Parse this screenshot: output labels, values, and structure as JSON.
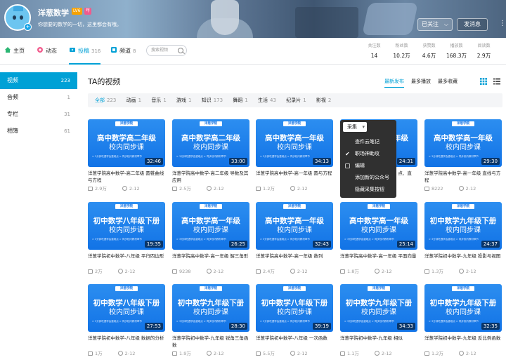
{
  "header": {
    "username": "洋葱数学",
    "level": "LV6",
    "vip_badge": "年",
    "avatar_badge": "+",
    "signature": "你想要的数学的一切，这里都会有哦。",
    "follow_label": "已关注",
    "message_label": "发消息",
    "more_icon": "⋮",
    "colors": {
      "accent": "#00a1d6",
      "level": "#f7a200",
      "vip": "#f05b8d"
    }
  },
  "nav": {
    "tabs": [
      {
        "label": "主页",
        "icon": "home-icon",
        "count": ""
      },
      {
        "label": "动态",
        "icon": "dynamic-icon",
        "count": ""
      },
      {
        "label": "投稿",
        "icon": "upload-icon",
        "count": "316"
      },
      {
        "label": "频道",
        "icon": "channel-icon",
        "count": "8"
      }
    ],
    "search_placeholder": "搜索视频",
    "stats": [
      {
        "label": "关注数",
        "value": "14"
      },
      {
        "label": "粉丝数",
        "value": "10.2万"
      },
      {
        "label": "获赞数",
        "value": "4.6万"
      },
      {
        "label": "播放数",
        "value": "168.3万"
      },
      {
        "label": "阅读数",
        "value": "2.9万"
      }
    ]
  },
  "sidebar": {
    "items": [
      {
        "label": "视频",
        "count": "223"
      },
      {
        "label": "音频",
        "count": "1"
      },
      {
        "label": "专栏",
        "count": "31"
      },
      {
        "label": "相簿",
        "count": "61"
      }
    ]
  },
  "main": {
    "title": "TA的视频",
    "sorts": [
      "最新发布",
      "最多播放",
      "最多收藏"
    ],
    "filters": [
      {
        "label": "全部",
        "count": "223"
      },
      {
        "label": "动画",
        "count": "1"
      },
      {
        "label": "音乐",
        "count": "1"
      },
      {
        "label": "游戏",
        "count": "1"
      },
      {
        "label": "知识",
        "count": "173"
      },
      {
        "label": "舞蹈",
        "count": "1"
      },
      {
        "label": "生活",
        "count": "43"
      },
      {
        "label": "纪录片",
        "count": "1"
      },
      {
        "label": "影视",
        "count": "2"
      }
    ],
    "thumb_logo": "洋葱学院",
    "thumb_sub": "校内同步课",
    "thumb_tagline": "> 3分钟吃透学会重难点    > 同步校内教材章节",
    "videos": [
      {
        "thumb": "高中数学高二年级",
        "duration": "32:46",
        "title": "洋葱学院高中数学-高二年级 圆锥曲线与方程",
        "plays": "2.9万",
        "date": "2-12"
      },
      {
        "thumb": "高中数学高二年级",
        "duration": "33:00",
        "title": "洋葱学院高中数学-高二年级 导数及其应用",
        "plays": "2.5万",
        "date": "2-12"
      },
      {
        "thumb": "高中数学高一年级",
        "duration": "34:13",
        "title": "洋葱学院高中数学-高一年级 圆与方程",
        "plays": "1.2万",
        "date": "2-12"
      },
      {
        "thumb": "高中数学高一年级",
        "duration": "24:31",
        "title": "洋葱学院高中数学-高一年级 点、直线、平面之间的位置关系",
        "plays": "1.1万",
        "date": "2-12"
      },
      {
        "thumb": "高中数学高一年级",
        "duration": "29:30",
        "title": "洋葱学院高中数学-高一年级 直线与方程",
        "plays": "8222",
        "date": "2-12"
      },
      {
        "thumb": "初中数学八年级下册",
        "duration": "19:35",
        "title": "洋葱学院初中数学-八年级 平行四边形",
        "plays": "2万",
        "date": "2-12"
      },
      {
        "thumb": "高中数学高一年级",
        "duration": "26:25",
        "title": "洋葱学院高中数学-高一年级 解三角形",
        "plays": "9238",
        "date": "2-12"
      },
      {
        "thumb": "高中数学高一年级",
        "duration": "32:43",
        "title": "洋葱学院高中数学-高一年级 数列",
        "plays": "2.4万",
        "date": "2-12"
      },
      {
        "thumb": "高中数学高一年级",
        "duration": "25:14",
        "title": "洋葱学院高中数学-高一年级 平面向量",
        "plays": "1.8万",
        "date": "2-12"
      },
      {
        "thumb": "初中数学九年级下册",
        "duration": "24:37",
        "title": "洋葱学院初中数学-九年级 投影与视图",
        "plays": "1.3万",
        "date": "2-12"
      },
      {
        "thumb": "初中数学八年级下册",
        "duration": "27:53",
        "title": "洋葱学院初中数学-八年级 数据的分析",
        "plays": "1万",
        "date": "2-12"
      },
      {
        "thumb": "初中数学九年级下册",
        "duration": "28:30",
        "title": "洋葱学院初中数学-九年级 锐角三角函数",
        "plays": "1.9万",
        "date": "2-12"
      },
      {
        "thumb": "初中数学八年级下册",
        "duration": "39:19",
        "title": "洋葱学院初中数学-八年级 一次函数",
        "plays": "5.5万",
        "date": "2-12"
      },
      {
        "thumb": "初中数学九年级下册",
        "duration": "34:33",
        "title": "洋葱学院初中数学-九年级 相似",
        "plays": "1.1万",
        "date": "2-12"
      },
      {
        "thumb": "初中数学九年级下册",
        "duration": "32:35",
        "title": "洋葱学院初中数学-九年级 反比例函数",
        "plays": "1.2万",
        "date": "2-12"
      }
    ]
  },
  "context_menu": {
    "header": "采集",
    "items": [
      {
        "label": "查件云笔记",
        "mark": ""
      },
      {
        "label": "职场神助攻",
        "mark": "✔"
      },
      {
        "label": "编辑",
        "mark": "box"
      },
      {
        "label": "添加新的公众号",
        "mark": ""
      },
      {
        "label": "隐藏采集按钮",
        "mark": ""
      }
    ]
  }
}
